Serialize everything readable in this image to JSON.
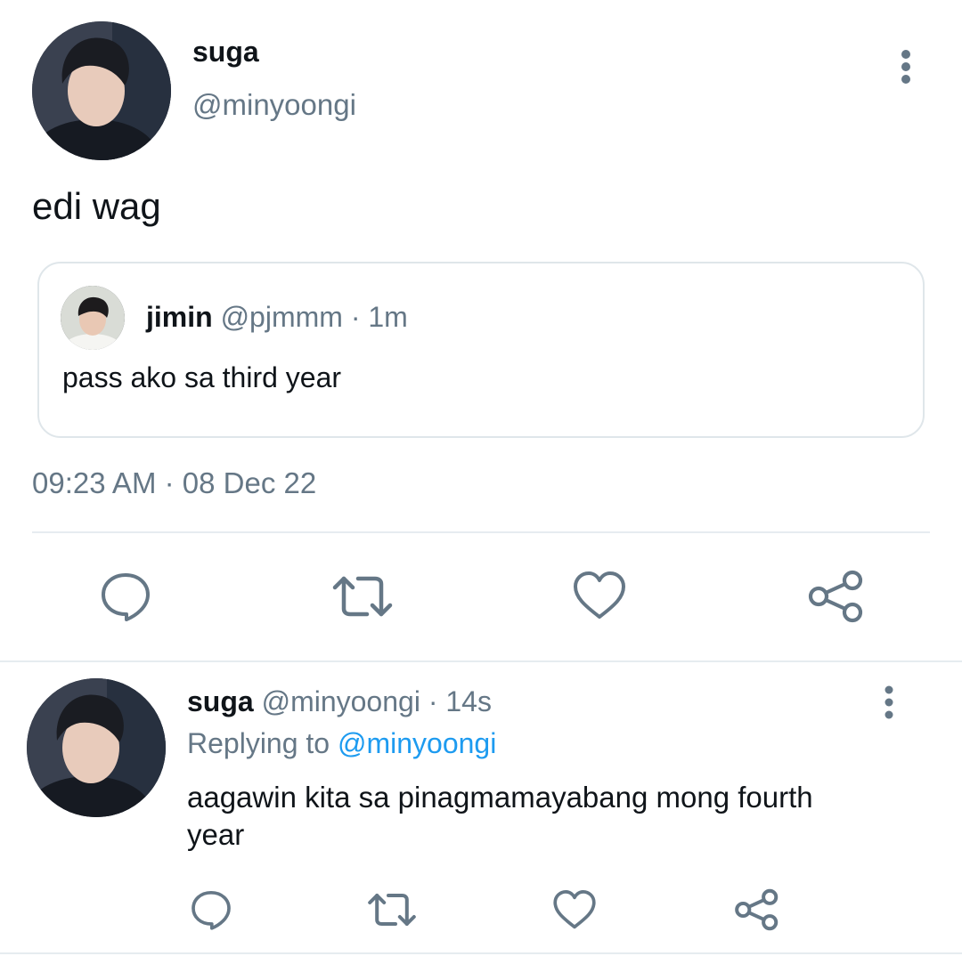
{
  "main_tweet": {
    "display_name": "suga",
    "handle": "@minyoongi",
    "text": "edi wag",
    "timestamp": "09:23 AM · 08 Dec 22",
    "quoted": {
      "display_name": "jimin",
      "handle": "@pjmmm",
      "time": "· 1m",
      "text": "pass ako sa third year"
    }
  },
  "reply_tweet": {
    "display_name": "suga",
    "handle": "@minyoongi",
    "time": "· 14s",
    "replying_prefix": "Replying to",
    "replying_handle": "@minyoongi",
    "text_line1": "aagawin kita sa pinagmamayabang mong fourth",
    "text_line2": "year"
  },
  "icons": {
    "more": "more-vertical-icon",
    "reply": "reply-icon",
    "retweet": "retweet-icon",
    "like": "heart-icon",
    "share": "share-icon"
  },
  "colors": {
    "text": "#0f1419",
    "muted": "#657786",
    "link": "#1d9bf0",
    "divider": "#e6ecf0"
  }
}
